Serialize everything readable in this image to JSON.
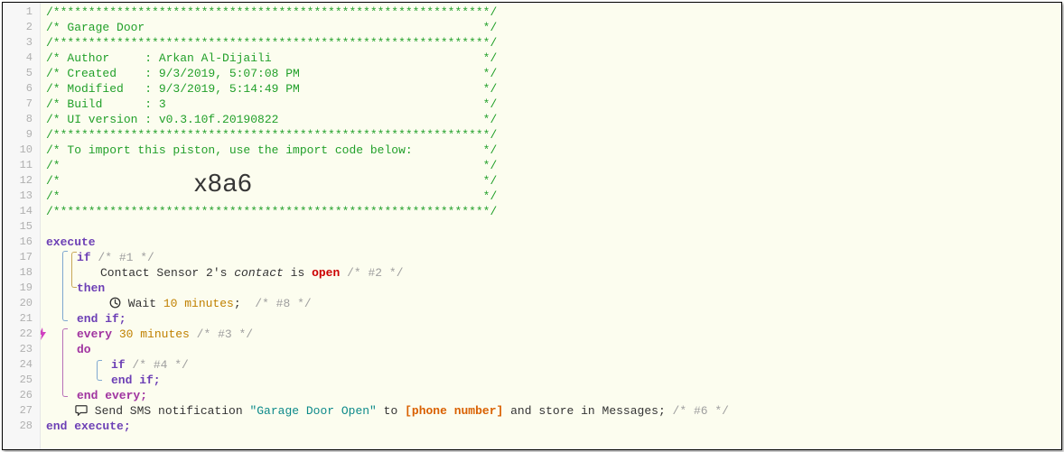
{
  "import_code": "x8a6",
  "header": {
    "title_line1": "/**************************************************************/",
    "title_line2": "/* Garage Door                                                */",
    "title_line3": "/**************************************************************/",
    "author": "/* Author     : Arkan Al-Dijaili                              */",
    "created": "/* Created    : 9/3/2019, 5:07:08 PM                          */",
    "modified": "/* Modified   : 9/3/2019, 5:14:49 PM                          */",
    "build": "/* Build      : 3                                             */",
    "ui_version": "/* UI version : v0.3.10f.20190822                             */",
    "sep": "/**************************************************************/",
    "import_lbl": "/* To import this piston, use the import code below:          */",
    "blank_c": "/*                                                            */"
  },
  "code": {
    "execute": "execute",
    "if": "if",
    "c1": "/* #1 */",
    "device": "Contact Sensor 2",
    "contact_txt": "'s ",
    "contact_word": "contact",
    "is": " is ",
    "open": "open",
    "c2": "/* #2 */",
    "then": "then",
    "wait_pre": " Wait ",
    "wait_num": "10",
    "wait_unit": " minutes",
    "semi": ";",
    "c8": "/* #8 */",
    "end_if": "end if;",
    "every": "every",
    "every_num": "30",
    "every_unit": "minutes",
    "c3": "/* #3 */",
    "do": "do",
    "c4": "/* #4 */",
    "end_every": "end every;",
    "send_pre": " Send SMS notification ",
    "msg": "\"Garage Door Open\"",
    "to": " to ",
    "phone": "[phone number]",
    "store": " and store in Messages; ",
    "c6": "/* #6 */",
    "end_execute": "end execute;"
  }
}
